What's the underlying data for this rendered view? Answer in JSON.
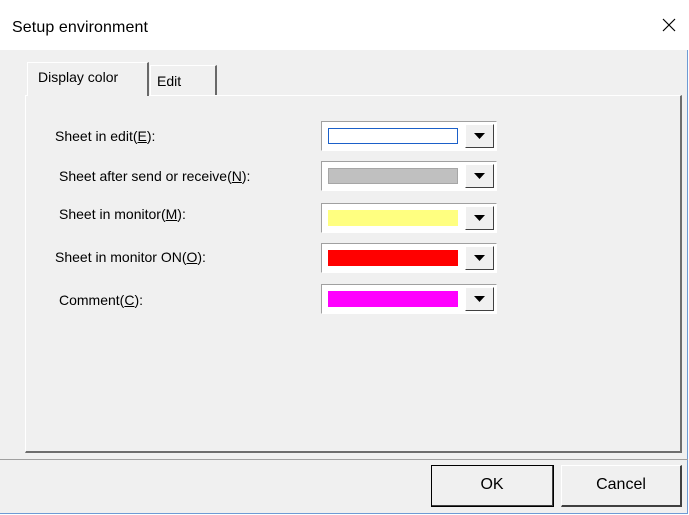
{
  "window": {
    "title": "Setup environment",
    "close_icon": "close-icon"
  },
  "tabs": [
    {
      "label": "Display color",
      "active": true
    },
    {
      "label": "Edit",
      "active": false
    }
  ],
  "rows": [
    {
      "prefix": "Sheet in edit(",
      "mnemonic": "E",
      "suffix": "):",
      "color": "#ffffff",
      "focused": true
    },
    {
      "prefix": "Sheet after send or receive(",
      "mnemonic": "N",
      "suffix": "):",
      "color": "#c0c0c0",
      "focused": false
    },
    {
      "prefix": "Sheet in monitor(",
      "mnemonic": "M",
      "suffix": "):",
      "color": "#ffff80",
      "focused": false
    },
    {
      "prefix": "Sheet in monitor ON(",
      "mnemonic": "O",
      "suffix": "):",
      "color": "#ff0000",
      "focused": false
    },
    {
      "prefix": "Comment(",
      "mnemonic": "C",
      "suffix": "):",
      "color": "#ff00ff",
      "focused": false
    }
  ],
  "buttons": {
    "ok": "OK",
    "cancel": "Cancel"
  }
}
